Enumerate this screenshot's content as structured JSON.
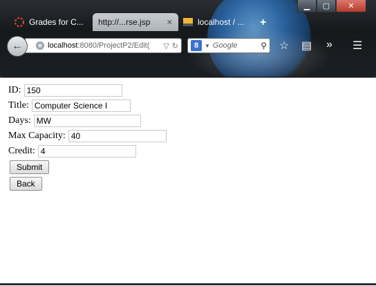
{
  "window": {
    "minimize": "▁",
    "maximize": "▢",
    "close": "✕"
  },
  "tabs": [
    {
      "title": "Grades for C...",
      "icon": "loading-spinner-icon"
    },
    {
      "title": "http://...rse.jsp",
      "icon": "page-icon",
      "active": true
    },
    {
      "title": "localhost / ...",
      "icon": "phpmyadmin-icon"
    }
  ],
  "nav": {
    "url_host": "localhost",
    "url_path": ":8080/ProjectP2/Edit(",
    "search_placeholder": "Google"
  },
  "form": {
    "id_label": "ID:",
    "id_value": "150",
    "title_label": "Title:",
    "title_value": "Computer Science I",
    "days_label": "Days:",
    "days_value": "MW",
    "capacity_label": "Max Capacity:",
    "capacity_value": "40",
    "credit_label": "Credit:",
    "credit_value": "4",
    "submit_label": "Submit",
    "back_label": "Back"
  }
}
